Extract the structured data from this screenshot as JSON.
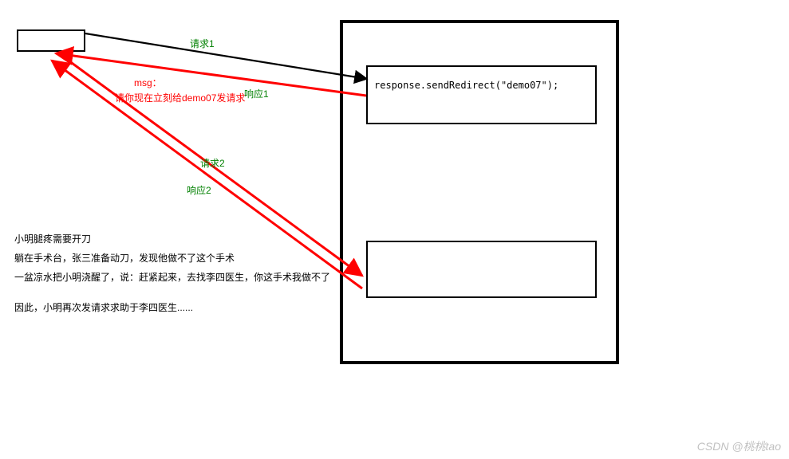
{
  "labels": {
    "req1": "请求1",
    "resp1": "响应1",
    "req2": "请求2",
    "resp2": "响应2",
    "msg_title": "msg：",
    "msg_body": "请你现在立刻给demo07发请求"
  },
  "code": {
    "redirect": "response.sendRedirect(\"demo07\");"
  },
  "story": {
    "line1": "小明腿疼需要开刀",
    "line2": "躺在手术台，张三准备动刀，发现他做不了这个手术",
    "line3": "一盆凉水把小明浇醒了，说：赶紧起来，去找李四医生，你这手术我做不了",
    "line4": "因此，小明再次发请求求助于李四医生......"
  },
  "watermark": "CSDN @桃桃tao"
}
